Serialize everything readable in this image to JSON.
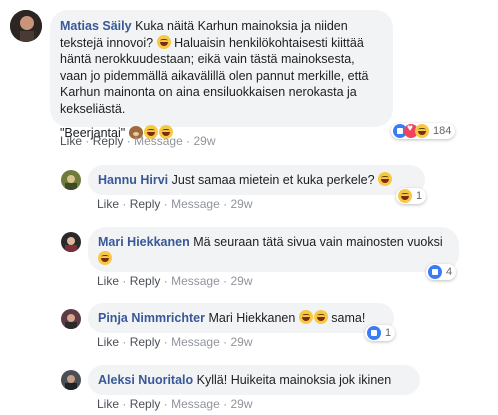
{
  "comments": [
    {
      "name": "Matias Säily",
      "text": "Kuka näitä Karhun mainoksia ja niiden tekstejä innovoi?",
      "text2": "Haluaisin henkilökohtaisesti kiittää häntä nerokkuudestaan; eikä vain tästä mainoksesta, vaan jo pidemmällä aikavälillä olen pannut merkille, että Karhun mainonta on aina ensiluokkaisen nerokasta ja kekseliästä.",
      "quote": "\"Beerjantai\"",
      "like": "Like",
      "reply": "Reply",
      "message": "Message",
      "time": "29w",
      "reaction_count": "184"
    },
    {
      "name": "Hannu Hirvi",
      "text": "Just samaa mietein et kuka perkele?",
      "like": "Like",
      "reply": "Reply",
      "message": "Message",
      "time": "29w",
      "reaction_count": "1"
    },
    {
      "name": "Mari Hiekkanen",
      "text": "Mä seuraan tätä sivua vain mainosten vuoksi",
      "like": "Like",
      "reply": "Reply",
      "message": "Message",
      "time": "29w",
      "reaction_count": "4"
    },
    {
      "name": "Pinja Nimmrichter",
      "text": "Mari Hiekkanen",
      "text2": "sama!",
      "like": "Like",
      "reply": "Reply",
      "message": "Message",
      "time": "29w",
      "reaction_count": "1"
    },
    {
      "name": "Aleksi Nuoritalo",
      "text": "Kyllä! Huikeita mainoksia jok ikinen",
      "like": "Like",
      "reply": "Reply",
      "message": "Message",
      "time": "29w"
    }
  ],
  "colors": {
    "name": "#385898",
    "bubble": "#f2f3f5",
    "meta": "#90949c"
  },
  "icons": {
    "laugh": "laughing-emoji-icon",
    "like": "like-reaction-icon",
    "love": "love-reaction-icon",
    "bear": "bear-emoji-icon"
  }
}
